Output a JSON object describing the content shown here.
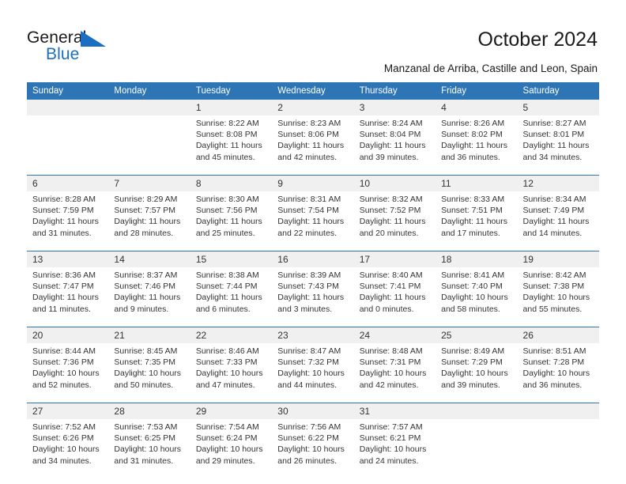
{
  "brand": {
    "line1": "General",
    "line2": "Blue",
    "flag_icon": "blue-triangle-flag-icon",
    "accent_color": "#1b6ec2"
  },
  "header": {
    "title": "October 2024",
    "subtitle": "Manzanal de Arriba, Castille and Leon, Spain"
  },
  "calendar": {
    "header_color": "#2e75b6",
    "daynum_band_color": "#f0f0f0",
    "weekday_headers": [
      "Sunday",
      "Monday",
      "Tuesday",
      "Wednesday",
      "Thursday",
      "Friday",
      "Saturday"
    ],
    "weeks": [
      [
        {
          "day": "",
          "lines": []
        },
        {
          "day": "",
          "lines": []
        },
        {
          "day": "1",
          "lines": [
            "Sunrise: 8:22 AM",
            "Sunset: 8:08 PM",
            "Daylight: 11 hours",
            "and 45 minutes."
          ]
        },
        {
          "day": "2",
          "lines": [
            "Sunrise: 8:23 AM",
            "Sunset: 8:06 PM",
            "Daylight: 11 hours",
            "and 42 minutes."
          ]
        },
        {
          "day": "3",
          "lines": [
            "Sunrise: 8:24 AM",
            "Sunset: 8:04 PM",
            "Daylight: 11 hours",
            "and 39 minutes."
          ]
        },
        {
          "day": "4",
          "lines": [
            "Sunrise: 8:26 AM",
            "Sunset: 8:02 PM",
            "Daylight: 11 hours",
            "and 36 minutes."
          ]
        },
        {
          "day": "5",
          "lines": [
            "Sunrise: 8:27 AM",
            "Sunset: 8:01 PM",
            "Daylight: 11 hours",
            "and 34 minutes."
          ]
        }
      ],
      [
        {
          "day": "6",
          "lines": [
            "Sunrise: 8:28 AM",
            "Sunset: 7:59 PM",
            "Daylight: 11 hours",
            "and 31 minutes."
          ]
        },
        {
          "day": "7",
          "lines": [
            "Sunrise: 8:29 AM",
            "Sunset: 7:57 PM",
            "Daylight: 11 hours",
            "and 28 minutes."
          ]
        },
        {
          "day": "8",
          "lines": [
            "Sunrise: 8:30 AM",
            "Sunset: 7:56 PM",
            "Daylight: 11 hours",
            "and 25 minutes."
          ]
        },
        {
          "day": "9",
          "lines": [
            "Sunrise: 8:31 AM",
            "Sunset: 7:54 PM",
            "Daylight: 11 hours",
            "and 22 minutes."
          ]
        },
        {
          "day": "10",
          "lines": [
            "Sunrise: 8:32 AM",
            "Sunset: 7:52 PM",
            "Daylight: 11 hours",
            "and 20 minutes."
          ]
        },
        {
          "day": "11",
          "lines": [
            "Sunrise: 8:33 AM",
            "Sunset: 7:51 PM",
            "Daylight: 11 hours",
            "and 17 minutes."
          ]
        },
        {
          "day": "12",
          "lines": [
            "Sunrise: 8:34 AM",
            "Sunset: 7:49 PM",
            "Daylight: 11 hours",
            "and 14 minutes."
          ]
        }
      ],
      [
        {
          "day": "13",
          "lines": [
            "Sunrise: 8:36 AM",
            "Sunset: 7:47 PM",
            "Daylight: 11 hours",
            "and 11 minutes."
          ]
        },
        {
          "day": "14",
          "lines": [
            "Sunrise: 8:37 AM",
            "Sunset: 7:46 PM",
            "Daylight: 11 hours",
            "and 9 minutes."
          ]
        },
        {
          "day": "15",
          "lines": [
            "Sunrise: 8:38 AM",
            "Sunset: 7:44 PM",
            "Daylight: 11 hours",
            "and 6 minutes."
          ]
        },
        {
          "day": "16",
          "lines": [
            "Sunrise: 8:39 AM",
            "Sunset: 7:43 PM",
            "Daylight: 11 hours",
            "and 3 minutes."
          ]
        },
        {
          "day": "17",
          "lines": [
            "Sunrise: 8:40 AM",
            "Sunset: 7:41 PM",
            "Daylight: 11 hours",
            "and 0 minutes."
          ]
        },
        {
          "day": "18",
          "lines": [
            "Sunrise: 8:41 AM",
            "Sunset: 7:40 PM",
            "Daylight: 10 hours",
            "and 58 minutes."
          ]
        },
        {
          "day": "19",
          "lines": [
            "Sunrise: 8:42 AM",
            "Sunset: 7:38 PM",
            "Daylight: 10 hours",
            "and 55 minutes."
          ]
        }
      ],
      [
        {
          "day": "20",
          "lines": [
            "Sunrise: 8:44 AM",
            "Sunset: 7:36 PM",
            "Daylight: 10 hours",
            "and 52 minutes."
          ]
        },
        {
          "day": "21",
          "lines": [
            "Sunrise: 8:45 AM",
            "Sunset: 7:35 PM",
            "Daylight: 10 hours",
            "and 50 minutes."
          ]
        },
        {
          "day": "22",
          "lines": [
            "Sunrise: 8:46 AM",
            "Sunset: 7:33 PM",
            "Daylight: 10 hours",
            "and 47 minutes."
          ]
        },
        {
          "day": "23",
          "lines": [
            "Sunrise: 8:47 AM",
            "Sunset: 7:32 PM",
            "Daylight: 10 hours",
            "and 44 minutes."
          ]
        },
        {
          "day": "24",
          "lines": [
            "Sunrise: 8:48 AM",
            "Sunset: 7:31 PM",
            "Daylight: 10 hours",
            "and 42 minutes."
          ]
        },
        {
          "day": "25",
          "lines": [
            "Sunrise: 8:49 AM",
            "Sunset: 7:29 PM",
            "Daylight: 10 hours",
            "and 39 minutes."
          ]
        },
        {
          "day": "26",
          "lines": [
            "Sunrise: 8:51 AM",
            "Sunset: 7:28 PM",
            "Daylight: 10 hours",
            "and 36 minutes."
          ]
        }
      ],
      [
        {
          "day": "27",
          "lines": [
            "Sunrise: 7:52 AM",
            "Sunset: 6:26 PM",
            "Daylight: 10 hours",
            "and 34 minutes."
          ]
        },
        {
          "day": "28",
          "lines": [
            "Sunrise: 7:53 AM",
            "Sunset: 6:25 PM",
            "Daylight: 10 hours",
            "and 31 minutes."
          ]
        },
        {
          "day": "29",
          "lines": [
            "Sunrise: 7:54 AM",
            "Sunset: 6:24 PM",
            "Daylight: 10 hours",
            "and 29 minutes."
          ]
        },
        {
          "day": "30",
          "lines": [
            "Sunrise: 7:56 AM",
            "Sunset: 6:22 PM",
            "Daylight: 10 hours",
            "and 26 minutes."
          ]
        },
        {
          "day": "31",
          "lines": [
            "Sunrise: 7:57 AM",
            "Sunset: 6:21 PM",
            "Daylight: 10 hours",
            "and 24 minutes."
          ]
        },
        {
          "day": "",
          "lines": []
        },
        {
          "day": "",
          "lines": []
        }
      ]
    ]
  }
}
